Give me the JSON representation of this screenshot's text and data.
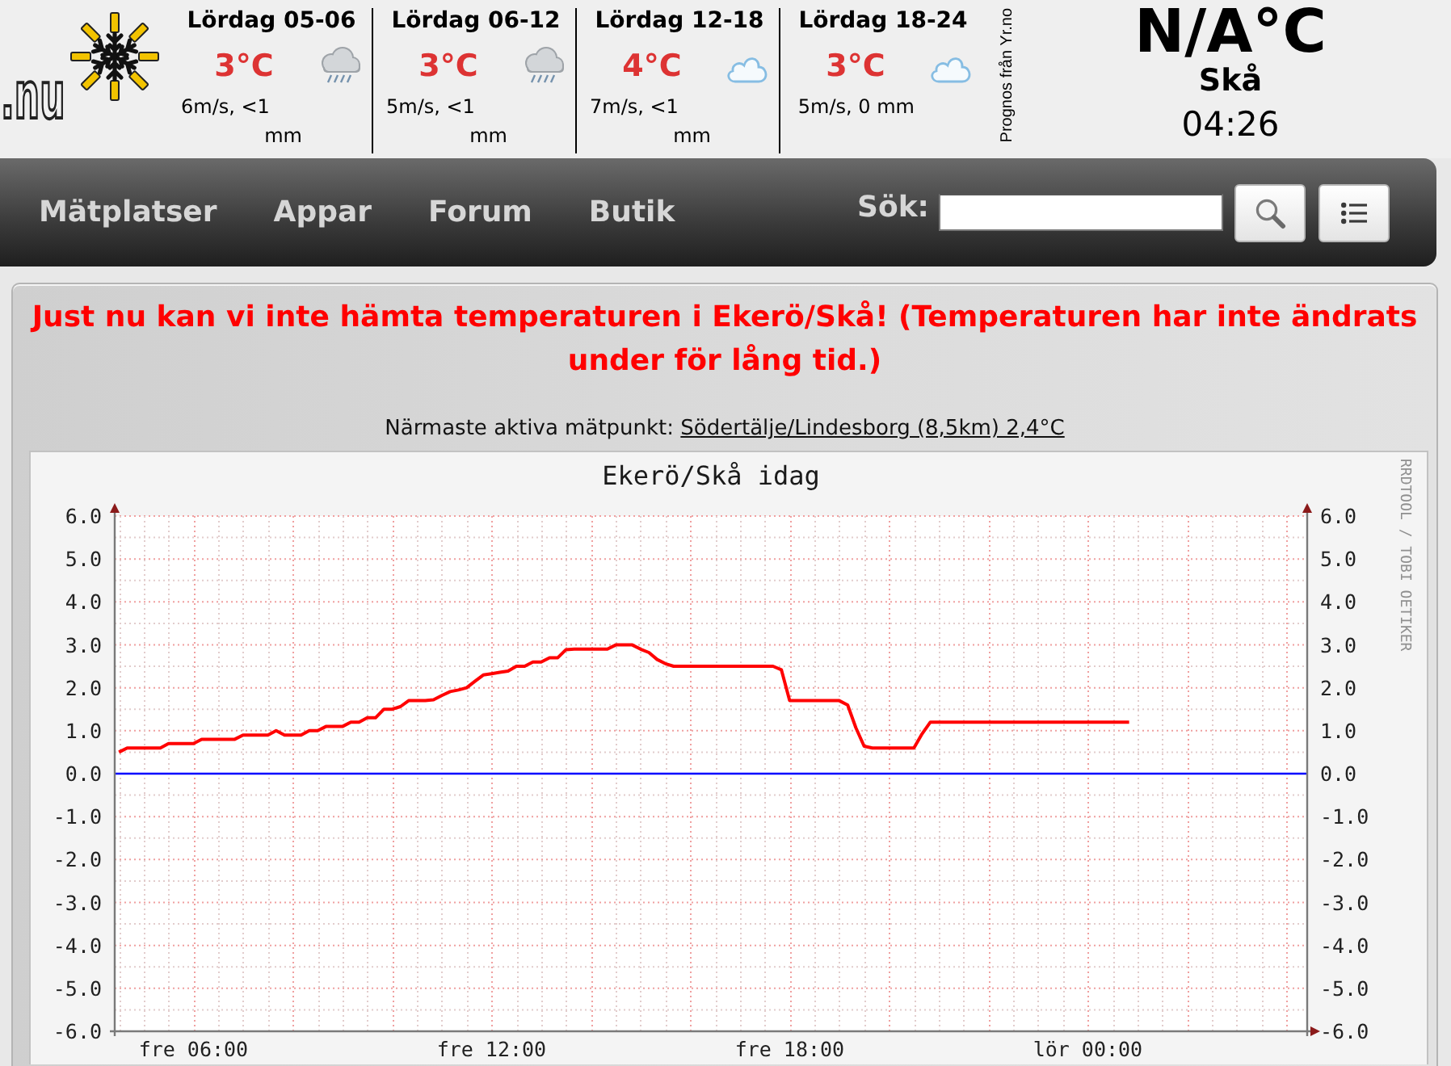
{
  "header": {
    "logo": {
      "text": ".nu"
    },
    "forecast": [
      {
        "period": "Lördag 05-06",
        "temperature": "3°C",
        "kind": "rain",
        "wind": "6m/s, <1 mm"
      },
      {
        "period": "Lördag 06-12",
        "temperature": "3°C",
        "kind": "rain",
        "wind": "5m/s, <1 mm"
      },
      {
        "period": "Lördag 12-18",
        "temperature": "4°C",
        "kind": "cloud",
        "wind": "7m/s, <1 mm"
      },
      {
        "period": "Lördag 18-24",
        "temperature": "3°C",
        "kind": "cloud",
        "wind": "5m/s, 0 mm"
      }
    ],
    "forecast_source": "Prognos från Yr.no",
    "current": {
      "temperature": "N/A°C",
      "place": "Skå",
      "time": "04:26"
    }
  },
  "nav": {
    "items": [
      "Mätplatser",
      "Appar",
      "Forum",
      "Butik"
    ],
    "search": {
      "label": "Sök:"
    }
  },
  "alert": "Just nu kan vi inte hämta temperaturen i Ekerö/Skå! (Temperaturen har inte ändrats under för lång tid.)",
  "nearest": {
    "label": "Närmaste aktiva mätpunkt:",
    "link": "Södertälje/Lindesborg (8,5km) 2,4°C"
  },
  "graph": {
    "credit": "RRDTOOL / TOBI OETIKER",
    "chart_data": {
      "type": "line",
      "title": "Ekerö/Skå idag",
      "grid": true,
      "categories": [
        null,
        null,
        null,
        null,
        null,
        null,
        null,
        null,
        null,
        "fre 06:00",
        null,
        null,
        null,
        null,
        null,
        null,
        null,
        null,
        null,
        null,
        null,
        null,
        null,
        null,
        null,
        null,
        null,
        null,
        null,
        null,
        null,
        null,
        null,
        null,
        null,
        null,
        null,
        null,
        null,
        null,
        null,
        null,
        null,
        null,
        null,
        "fre 12:00",
        null,
        null,
        null,
        null,
        null,
        null,
        null,
        null,
        null,
        null,
        null,
        null,
        null,
        null,
        null,
        null,
        null,
        null,
        null,
        null,
        null,
        null,
        null,
        null,
        null,
        null,
        null,
        null,
        null,
        null,
        null,
        null,
        null,
        null,
        null,
        "fre 18:00",
        null,
        null,
        null,
        null,
        null,
        null,
        null,
        null,
        null,
        null,
        null,
        null,
        null,
        null,
        null,
        null,
        null,
        null,
        null,
        null,
        null,
        null,
        null,
        null,
        null,
        null,
        null,
        null,
        null,
        null,
        null,
        null,
        null,
        null,
        null,
        "lör 00:00",
        null,
        null,
        null,
        null,
        null,
        null,
        null,
        null,
        null,
        null,
        null,
        null,
        null,
        null,
        null,
        null,
        null,
        null,
        null,
        null,
        null,
        null,
        null,
        null,
        null,
        null
      ],
      "series": [
        {
          "color": "#ff0000",
          "values": [
            0.5,
            0.6,
            0.6,
            0.6,
            0.6,
            0.6,
            0.7,
            0.7,
            0.7,
            0.7,
            0.8,
            0.8,
            0.8,
            0.8,
            0.8,
            0.9,
            0.9,
            0.9,
            0.9,
            1.0,
            0.9,
            0.9,
            0.9,
            1.0,
            1.0,
            1.1,
            1.1,
            1.1,
            1.2,
            1.2,
            1.3,
            1.3,
            1.5,
            1.5,
            1.56,
            1.7,
            1.7,
            1.7,
            1.72,
            1.82,
            1.91,
            1.95,
            2.0,
            2.15,
            2.3,
            2.33,
            2.36,
            2.39,
            2.5,
            2.5,
            2.6,
            2.6,
            2.7,
            2.7,
            2.89,
            2.9,
            2.9,
            2.9,
            2.9,
            2.9,
            3.0,
            3.0,
            3.0,
            2.9,
            2.82,
            2.66,
            2.56,
            2.5,
            2.5,
            2.5,
            2.5,
            2.5,
            2.5,
            2.5,
            2.5,
            2.5,
            2.5,
            2.5,
            2.5,
            2.5,
            2.42,
            1.7,
            1.7,
            1.7,
            1.7,
            1.7,
            1.7,
            1.7,
            1.6,
            1.07,
            0.64,
            0.6,
            0.6,
            0.6,
            0.6,
            0.6,
            0.6,
            0.93,
            1.2,
            1.2,
            1.2,
            1.2,
            1.2,
            1.2,
            1.2,
            1.2,
            1.2,
            1.2,
            1.2,
            1.2,
            1.2,
            1.2,
            1.2,
            1.2,
            1.2,
            1.2,
            1.2,
            1.2,
            1.2,
            1.2,
            1.2,
            1.2,
            1.2,
            null,
            null,
            null,
            null,
            null,
            null,
            null,
            null,
            null,
            null,
            null,
            null,
            null,
            null,
            null,
            null,
            null,
            null,
            null,
            null,
            null
          ]
        }
      ],
      "ylim": [
        -6,
        6
      ],
      "y2lim": [
        -6,
        6
      ],
      "yticks": [
        {
          "value": 6,
          "label": "6.0"
        },
        {
          "value": 5,
          "label": "5.0"
        },
        {
          "value": 4,
          "label": "4.0"
        },
        {
          "value": 3,
          "label": "3.0"
        },
        {
          "value": 2,
          "label": "2.0"
        },
        {
          "value": 1,
          "label": "1.0"
        },
        {
          "value": 0,
          "label": "0.0"
        },
        {
          "value": -1,
          "label": "-1.0"
        },
        {
          "value": -2,
          "label": "-2.0"
        },
        {
          "value": -3,
          "label": "-3.0"
        },
        {
          "value": -4,
          "label": "-4.0"
        },
        {
          "value": -5,
          "label": "-5.0"
        },
        {
          "value": -6,
          "label": "-6.0"
        }
      ],
      "y2ticks": [
        {
          "value": 6,
          "label": "6.0"
        },
        {
          "value": 5,
          "label": "5.0"
        },
        {
          "value": 4,
          "label": "4.0"
        },
        {
          "value": 3,
          "label": "3.0"
        },
        {
          "value": 2,
          "label": "2.0"
        },
        {
          "value": 1,
          "label": "1.0"
        },
        {
          "value": 0,
          "label": "0.0"
        },
        {
          "value": -1,
          "label": "-1.0"
        },
        {
          "value": -2,
          "label": "-2.0"
        },
        {
          "value": -3,
          "label": "-3.0"
        },
        {
          "value": -4,
          "label": "-4.0"
        },
        {
          "value": -5,
          "label": "-5.0"
        },
        {
          "value": -6,
          "label": "-6.0"
        }
      ],
      "ref_lines": [
        {
          "axis": "y",
          "value": 0,
          "color": "#0000ff"
        }
      ]
    }
  }
}
